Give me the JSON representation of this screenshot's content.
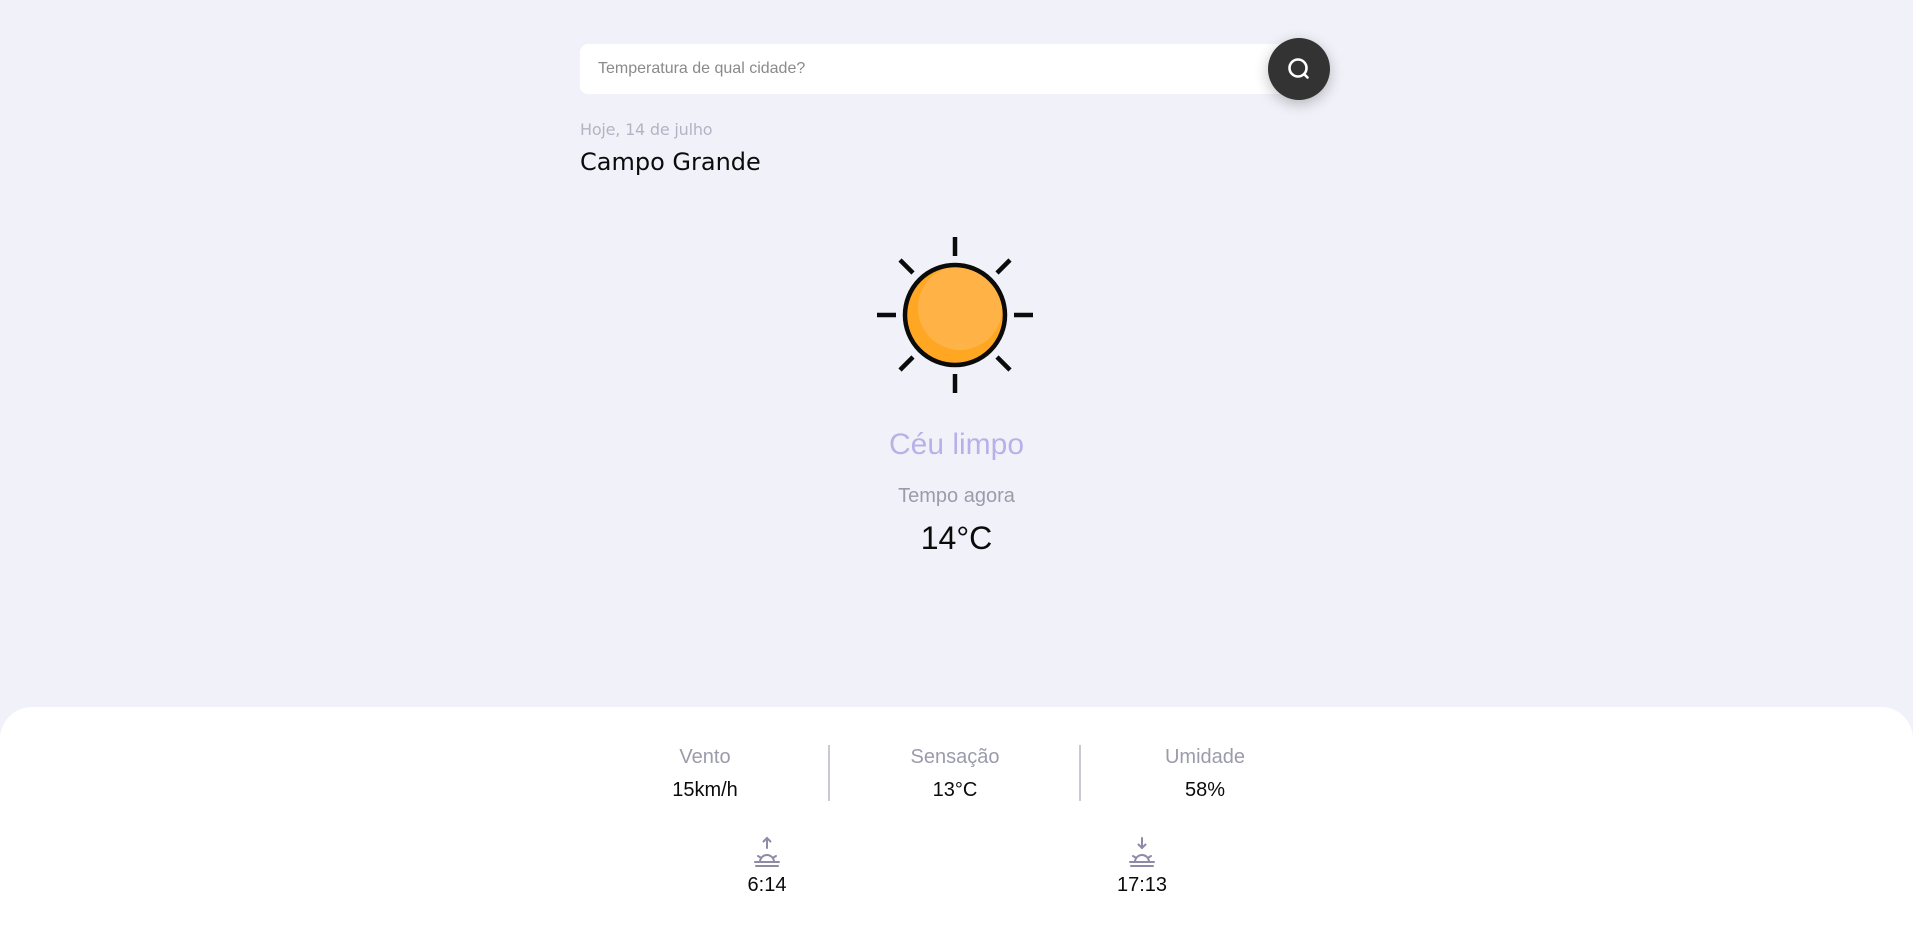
{
  "search": {
    "placeholder": "Temperatura de qual cidade?",
    "value": ""
  },
  "header": {
    "date": "Hoje, 14 de julho",
    "city": "Campo Grande"
  },
  "current": {
    "icon": "sun-icon",
    "condition": "Céu limpo",
    "now_label": "Tempo agora",
    "temperature": "14°C"
  },
  "details": [
    {
      "label": "Vento",
      "value": "15km/h"
    },
    {
      "label": "Sensação",
      "value": "13°C"
    },
    {
      "label": "Umidade",
      "value": "58%"
    }
  ],
  "sun": {
    "sunrise": {
      "icon": "sunrise-icon",
      "time": "6:14"
    },
    "sunset": {
      "icon": "sunset-icon",
      "time": "17:13"
    }
  },
  "colors": {
    "background": "#f1f2f9",
    "panel": "#ffffff",
    "button": "#333333",
    "condition_text": "#b6b2e8",
    "sun_fill": "#ffa623",
    "icon_muted": "#8e8ba6"
  }
}
